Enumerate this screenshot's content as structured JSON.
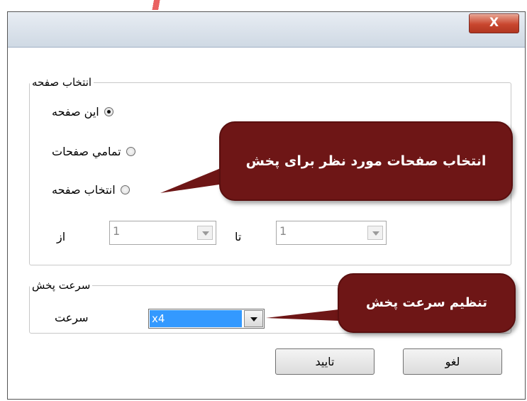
{
  "window": {
    "close_label": "X"
  },
  "page_selection": {
    "legend": "انتخاب صفحه",
    "options": [
      {
        "label": "اين صفحه",
        "checked": true
      },
      {
        "label": "تمامي صفحات",
        "checked": false
      },
      {
        "label": "انتخاب صفحه",
        "checked": false
      }
    ],
    "from_label": "از",
    "from_value": "1",
    "to_label": "تا",
    "to_value": "1"
  },
  "speed": {
    "legend": "سرعت پخش",
    "label": "سرعت",
    "selected_value": "x4"
  },
  "buttons": {
    "ok": "تاييد",
    "cancel": "لغو"
  },
  "annotations": {
    "pages_callout": "انتخاب صفحات مورد نظر برای پخش",
    "speed_callout": "تنظیم سرعت پخش"
  },
  "colors": {
    "callout_bg": "#6e1616",
    "selection_highlight": "#3399ff",
    "close_button": "#c9472f"
  }
}
